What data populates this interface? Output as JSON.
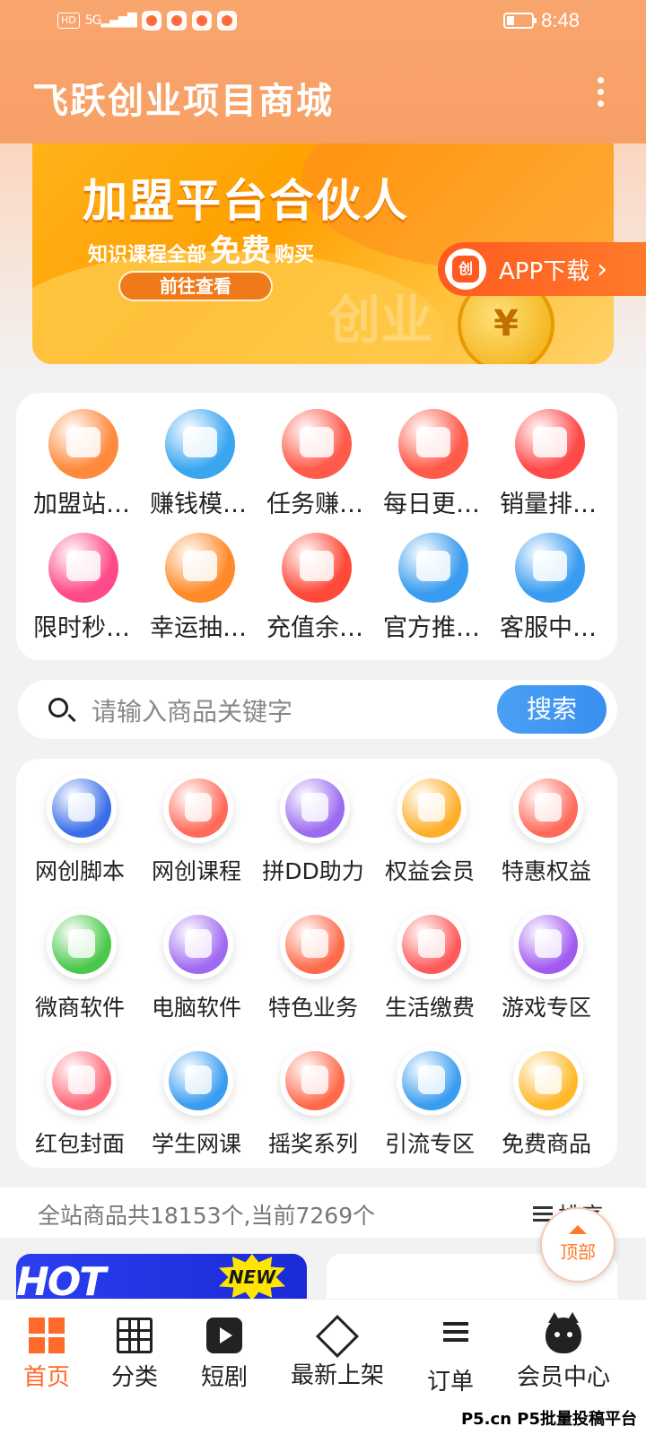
{
  "status_bar": {
    "network_badge": "HD",
    "signal": "5G",
    "time": "8:48"
  },
  "header": {
    "title": "飞跃创业项目商城"
  },
  "banner": {
    "title": "加盟平台合伙人",
    "subtitle_prefix": "知识课程全部",
    "subtitle_highlight": "免费",
    "subtitle_suffix": "购买",
    "cta": "前往查看",
    "coin_symbol": "¥",
    "watermark": "创业"
  },
  "app_download": {
    "logo_text": "创",
    "label": "APP下载",
    "chevron": "›"
  },
  "quick_menu": [
    {
      "label": "加盟站…",
      "icon": "shop-icon",
      "color": "#ff8a3d"
    },
    {
      "label": "赚钱模…",
      "icon": "book-icon",
      "color": "#3aa6f0"
    },
    {
      "label": "任务赚…",
      "icon": "task-icon",
      "color": "#ff5a4a"
    },
    {
      "label": "每日更…",
      "icon": "bag-icon",
      "color": "#ff5a4a"
    },
    {
      "label": "销量排…",
      "icon": "rank-icon",
      "color": "#ff4a4a"
    },
    {
      "label": "限时秒…",
      "icon": "alarm-icon",
      "color": "#ff4a8a"
    },
    {
      "label": "幸运抽…",
      "icon": "ticket-icon",
      "color": "#ff8a2a"
    },
    {
      "label": "充值余…",
      "icon": "wallet-icon",
      "color": "#ff4a3a"
    },
    {
      "label": "官方推…",
      "icon": "megaphone-icon",
      "color": "#3a9cf0"
    },
    {
      "label": "客服中…",
      "icon": "service-icon",
      "color": "#3a9cf0"
    }
  ],
  "search": {
    "placeholder": "请输入商品关键字",
    "button": "搜索"
  },
  "categories": [
    {
      "label": "网创脚本",
      "icon": "flame-blue-icon",
      "color": "#3a6ee8"
    },
    {
      "label": "网创课程",
      "icon": "flame-red-icon",
      "color": "#ff6a5a"
    },
    {
      "label": "拼DD助力",
      "icon": "vip-icon",
      "color": "#9a6af0"
    },
    {
      "label": "权益会员",
      "icon": "coins-icon",
      "color": "#ffae2a"
    },
    {
      "label": "特惠权益",
      "icon": "burger-icon",
      "color": "#ff6a5a"
    },
    {
      "label": "微商软件",
      "icon": "u-green-icon",
      "color": "#4ac84a"
    },
    {
      "label": "电脑软件",
      "icon": "u-purple-icon",
      "color": "#a06af0"
    },
    {
      "label": "特色业务",
      "icon": "alarm-bolt-icon",
      "color": "#ff6a4a"
    },
    {
      "label": "生活缴费",
      "icon": "wallet-red-icon",
      "color": "#ff5a5a"
    },
    {
      "label": "游戏专区",
      "icon": "gamepad-icon",
      "color": "#a05af0"
    },
    {
      "label": "红包封面",
      "icon": "redpacket-icon",
      "color": "#ff6a7a"
    },
    {
      "label": "学生网课",
      "icon": "graduation-icon",
      "color": "#3a9cf0"
    },
    {
      "label": "摇奖系列",
      "icon": "star-hand-icon",
      "color": "#ff6a4a"
    },
    {
      "label": "引流专区",
      "icon": "people-icon",
      "color": "#3a9cf0"
    },
    {
      "label": "免费商品",
      "icon": "gift-box-icon",
      "color": "#ffb82a"
    }
  ],
  "stats": {
    "text": "全站商品共18153个,当前7269个",
    "sort_label": "排序"
  },
  "to_top": {
    "label": "顶部"
  },
  "products": {
    "hot_label": "HOT",
    "new_label": "NEW"
  },
  "bottom_nav": [
    {
      "label": "首页",
      "icon": "home-windows-icon",
      "active": true
    },
    {
      "label": "分类",
      "icon": "grid-icon",
      "active": false
    },
    {
      "label": "短剧",
      "icon": "play-icon",
      "active": false
    },
    {
      "label": "最新上架",
      "icon": "diamond-icon",
      "active": false
    },
    {
      "label": "订单",
      "icon": "numbered-list-icon",
      "active": false
    },
    {
      "label": "会员中心",
      "icon": "cat-icon",
      "active": false
    }
  ],
  "watermark": "P5.cn P5批量投稿平台",
  "colors": {
    "header": "#f9a56e",
    "accent": "#ff6a2a",
    "search_button": "#3a8ff0"
  }
}
